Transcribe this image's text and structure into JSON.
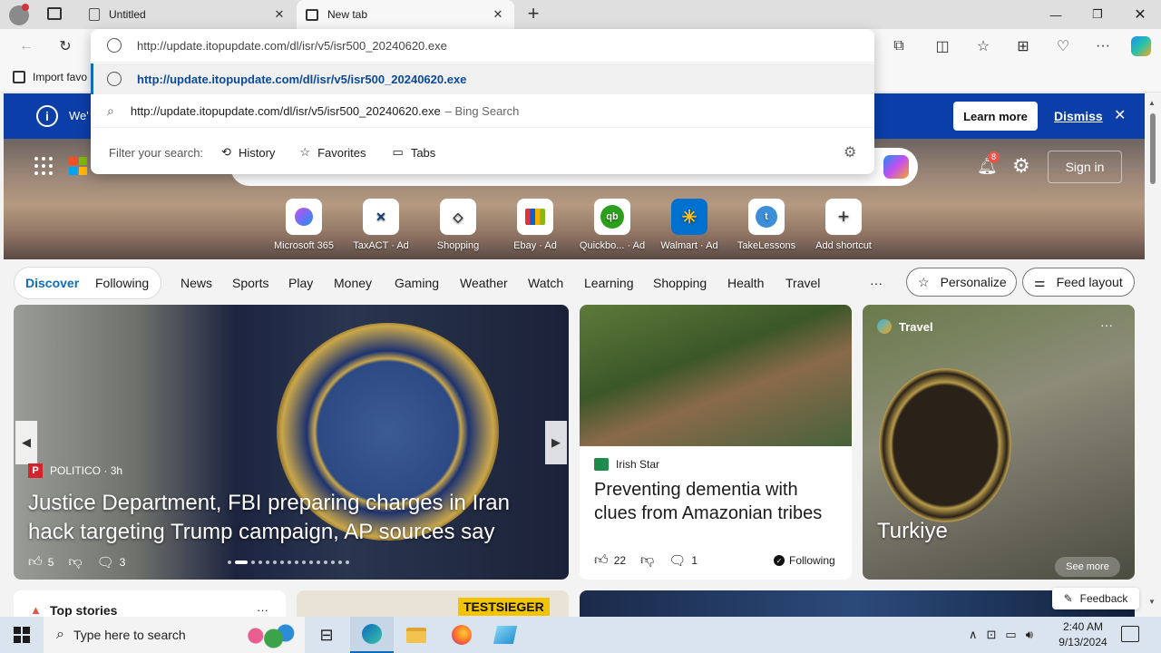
{
  "tabs": [
    {
      "title": "Untitled"
    },
    {
      "title": "New tab"
    }
  ],
  "omnibox": {
    "input_value": "http://update.itopupdate.com/dl/isr/v5/isr500_20240620.exe",
    "suggestion_url": "http://update.itopupdate.com/dl/isr/v5/isr500_20240620.exe",
    "suggestion_search": "http://update.itopupdate.com/dl/isr/v5/isr500_20240620.exe",
    "suggestion_search_suffix": "– Bing Search",
    "filter_label": "Filter your search:",
    "filters": [
      "History",
      "Favorites",
      "Tabs"
    ]
  },
  "favorites_bar": {
    "import_label": "Import favo"
  },
  "infobar": {
    "text": "We'",
    "learn_more": "Learn more",
    "dismiss": "Dismiss"
  },
  "header": {
    "sign_in": "Sign in",
    "notification_count": "8"
  },
  "shortcuts": [
    {
      "label": "Microsoft 365",
      "ad": ""
    },
    {
      "label": "TaxACT",
      "ad": "· Ad"
    },
    {
      "label": "Shopping",
      "ad": ""
    },
    {
      "label": "Ebay",
      "ad": "· Ad"
    },
    {
      "label": "Quickbo...",
      "ad": "· Ad"
    },
    {
      "label": "Walmart",
      "ad": "· Ad"
    },
    {
      "label": "TakeLessons",
      "ad": ""
    },
    {
      "label": "Add shortcut",
      "ad": ""
    }
  ],
  "feed_tabs": {
    "discover": "Discover",
    "following": "Following"
  },
  "nav": [
    "News",
    "Sports",
    "Play",
    "Money",
    "Gaming",
    "Weather",
    "Watch",
    "Learning",
    "Shopping",
    "Health",
    "Travel"
  ],
  "more_label": "···",
  "personalize": "Personalize",
  "feed_layout": "Feed layout",
  "hero_story": {
    "source": "POLITICO",
    "age": "· 3h",
    "headline": "Justice Department, FBI preparing charges in Iran hack targeting Trump campaign, AP sources say",
    "likes": "5",
    "comments": "3"
  },
  "story2": {
    "source": "Irish Star",
    "headline": "Preventing dementia with clues from Amazonian tribes",
    "likes": "22",
    "comments": "1",
    "following": "Following"
  },
  "story3": {
    "category": "Travel",
    "title": "Turkiye",
    "see_more": "See more"
  },
  "bottom": {
    "top_stories": "Top stories",
    "testsieger": "TESTSIEGER",
    "feedback": "Feedback"
  },
  "taskbar": {
    "search_placeholder": "Type here to search",
    "time": "2:40 AM",
    "date": "9/13/2024"
  },
  "colors": {
    "accent": "#0f6cbd",
    "infobar": "#0b3ea8",
    "taskbar": "#d9e4ef"
  }
}
